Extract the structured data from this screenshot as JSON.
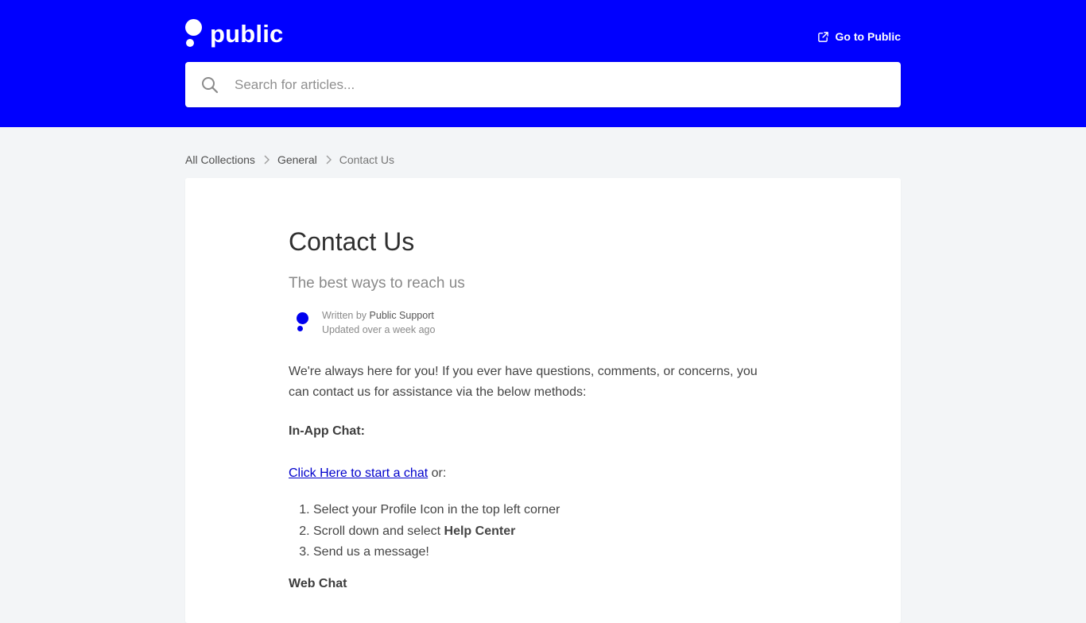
{
  "header": {
    "logo_text": "public",
    "go_to_label": "Go to Public",
    "search_placeholder": "Search for articles..."
  },
  "breadcrumb": {
    "items": [
      "All Collections",
      "General"
    ],
    "current": "Contact Us"
  },
  "article": {
    "title": "Contact Us",
    "subtitle": "The best ways to reach us",
    "written_by_prefix": "Written by",
    "author": "Public Support",
    "updated": "Updated over a week ago",
    "intro_line1": "We're always here for you! If you ever have questions, comments, or concerns, you",
    "intro_line2": "can contact us for assistance via the below methods:",
    "section_inapp": "In-App Chat:",
    "chat_link": "Click Here to start a chat",
    "chat_suffix": " or:",
    "steps": {
      "s1": "Select your Profile Icon in the top left corner",
      "s2_prefix": "Scroll down and select ",
      "s2_bold": "Help Center",
      "s3": "Send us a message!"
    },
    "section_web": "Web Chat"
  },
  "icons": {
    "logo": "public-logo-icon",
    "external_link": "external-link-icon",
    "search": "search-icon",
    "chevron": "chevron-right-icon",
    "avatar": "public-avatar-icon"
  },
  "colors": {
    "header_bg": "#0000ff",
    "page_bg": "#f3f5f7",
    "link": "#0000cc"
  }
}
